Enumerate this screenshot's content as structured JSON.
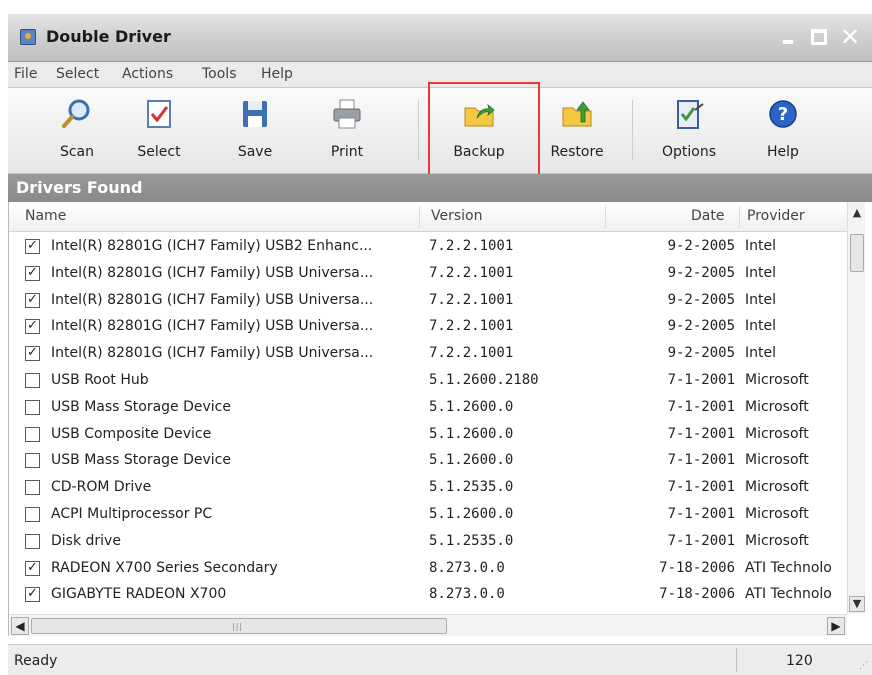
{
  "window": {
    "title": "Double Driver"
  },
  "menu": [
    "File",
    "Select",
    "Actions",
    "Tools",
    "Help"
  ],
  "toolbar": {
    "scan": "Scan",
    "select": "Select",
    "save": "Save",
    "print": "Print",
    "backup": "Backup",
    "restore": "Restore",
    "options": "Options",
    "help": "Help"
  },
  "band": {
    "title": "Drivers Found"
  },
  "columns": {
    "name": "Name",
    "version": "Version",
    "date": "Date",
    "provider": "Provider"
  },
  "rows": [
    {
      "checked": true,
      "name": "Intel(R) 82801G (ICH7 Family) USB2 Enhanc...",
      "version": "7.2.2.1001",
      "date": "9-2-2005",
      "provider": "Intel"
    },
    {
      "checked": true,
      "name": "Intel(R) 82801G (ICH7 Family) USB Universa...",
      "version": "7.2.2.1001",
      "date": "9-2-2005",
      "provider": "Intel"
    },
    {
      "checked": true,
      "name": "Intel(R) 82801G (ICH7 Family) USB Universa...",
      "version": "7.2.2.1001",
      "date": "9-2-2005",
      "provider": "Intel"
    },
    {
      "checked": true,
      "name": "Intel(R) 82801G (ICH7 Family) USB Universa...",
      "version": "7.2.2.1001",
      "date": "9-2-2005",
      "provider": "Intel"
    },
    {
      "checked": true,
      "name": "Intel(R) 82801G (ICH7 Family) USB Universa...",
      "version": "7.2.2.1001",
      "date": "9-2-2005",
      "provider": "Intel"
    },
    {
      "checked": false,
      "name": "USB Root Hub",
      "version": "5.1.2600.2180",
      "date": "7-1-2001",
      "provider": "Microsoft"
    },
    {
      "checked": false,
      "name": "USB Mass Storage Device",
      "version": "5.1.2600.0",
      "date": "7-1-2001",
      "provider": "Microsoft"
    },
    {
      "checked": false,
      "name": "USB Composite Device",
      "version": "5.1.2600.0",
      "date": "7-1-2001",
      "provider": "Microsoft"
    },
    {
      "checked": false,
      "name": "USB Mass Storage Device",
      "version": "5.1.2600.0",
      "date": "7-1-2001",
      "provider": "Microsoft"
    },
    {
      "checked": false,
      "name": "CD-ROM Drive",
      "version": "5.1.2535.0",
      "date": "7-1-2001",
      "provider": "Microsoft"
    },
    {
      "checked": false,
      "name": "ACPI Multiprocessor PC",
      "version": "5.1.2600.0",
      "date": "7-1-2001",
      "provider": "Microsoft"
    },
    {
      "checked": false,
      "name": "Disk drive",
      "version": "5.1.2535.0",
      "date": "7-1-2001",
      "provider": "Microsoft"
    },
    {
      "checked": true,
      "name": "RADEON X700 Series Secondary",
      "version": "8.273.0.0",
      "date": "7-18-2006",
      "provider": "ATI Technolo"
    },
    {
      "checked": true,
      "name": "GIGABYTE RADEON X700",
      "version": "8.273.0.0",
      "date": "7-18-2006",
      "provider": "ATI Technolo"
    }
  ],
  "status": {
    "text": "Ready",
    "count": "120"
  },
  "colors": {
    "highlight": "#e53a3a",
    "band": "#8f8f8f"
  },
  "icons": [
    "app-icon",
    "magnifier-icon",
    "select-check-icon",
    "floppy-save-icon",
    "printer-icon",
    "folder-backup-icon",
    "folder-restore-icon",
    "options-clipboard-icon",
    "help-question-icon"
  ]
}
